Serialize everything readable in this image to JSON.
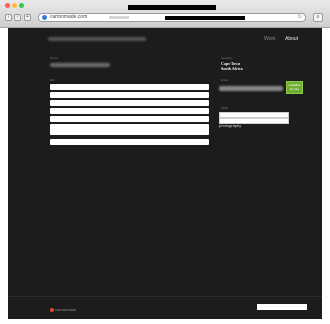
{
  "browser": {
    "url": "cartonmade.com",
    "back_glyph": "‹",
    "forward_glyph": "›",
    "reload_glyph": "↻",
    "menu_glyph": "≡"
  },
  "nav": {
    "work": "Work",
    "about": "About"
  },
  "profile": {
    "label_name": "Name",
    "label_bio": "Bio",
    "label_location": "Location",
    "city": "Cape Town",
    "country": "South Africa",
    "label_email": "Email",
    "label_skills": "Skills",
    "badge_text": "Available for hire",
    "interest": "photography"
  },
  "footer": {
    "logo_text": "cartonmade"
  },
  "colors": {
    "page_bg": "#1c1c1c",
    "accent_green": "#6fae31"
  }
}
